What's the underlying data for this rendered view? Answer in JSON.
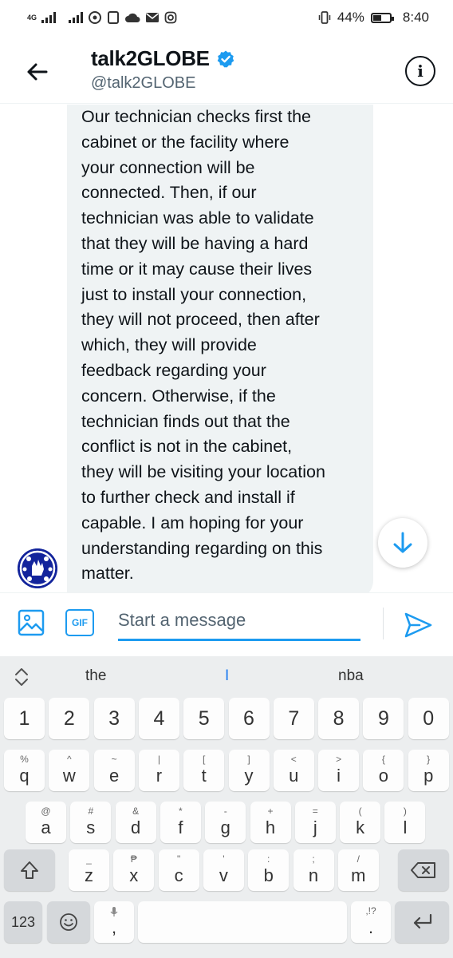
{
  "status_bar": {
    "network_label": "4G",
    "battery_percent": "44%",
    "time": "8:40"
  },
  "header": {
    "title": "talk2GLOBE",
    "handle": "@talk2GLOBE",
    "back_icon": "arrow-left-icon",
    "verified_icon": "verified-badge-icon",
    "info_icon": "info-icon",
    "info_glyph": "i"
  },
  "messages": [
    {
      "sender": "talk2GLOBE",
      "text": "Our technician checks first the\ncabinet or the facility where\nyour connection will be\nconnected. Then, if our\ntechnician was able to validate\nthat they will be having a hard\ntime or it may cause their lives\njust to install your connection,\nthey will not proceed, then after\nwhich, they will provide\nfeedback regarding your\nconcern. Otherwise, if the\ntechnician finds out that the\nconflict is not in the cabinet,\nthey will be visiting your location\nto further check and install if\ncapable. I am hoping for your\nunderstanding regarding on this\nmatter."
    }
  ],
  "composer": {
    "placeholder": "Start a message",
    "gif_label": "GIF",
    "media_icon": "image-icon",
    "send_icon": "send-icon"
  },
  "keyboard": {
    "suggestions": [
      "the",
      "I",
      "nba"
    ],
    "number_row": [
      "1",
      "2",
      "3",
      "4",
      "5",
      "6",
      "7",
      "8",
      "9",
      "0"
    ],
    "row1": [
      {
        "sub": "%",
        "main": "q"
      },
      {
        "sub": "^",
        "main": "w"
      },
      {
        "sub": "~",
        "main": "e"
      },
      {
        "sub": "|",
        "main": "r"
      },
      {
        "sub": "[",
        "main": "t"
      },
      {
        "sub": "]",
        "main": "y"
      },
      {
        "sub": "<",
        "main": "u"
      },
      {
        "sub": ">",
        "main": "i"
      },
      {
        "sub": "{",
        "main": "o"
      },
      {
        "sub": "}",
        "main": "p"
      }
    ],
    "row2": [
      {
        "sub": "@",
        "main": "a"
      },
      {
        "sub": "#",
        "main": "s"
      },
      {
        "sub": "&",
        "main": "d"
      },
      {
        "sub": "*",
        "main": "f"
      },
      {
        "sub": "-",
        "main": "g"
      },
      {
        "sub": "+",
        "main": "h"
      },
      {
        "sub": "=",
        "main": "j"
      },
      {
        "sub": "(",
        "main": "k"
      },
      {
        "sub": ")",
        "main": "l"
      }
    ],
    "row3": [
      {
        "sub": "_",
        "main": "z"
      },
      {
        "sub": "₱",
        "main": "x"
      },
      {
        "sub": "\"",
        "main": "c"
      },
      {
        "sub": "'",
        "main": "v"
      },
      {
        "sub": ":",
        "main": "b"
      },
      {
        "sub": ";",
        "main": "n"
      },
      {
        "sub": "/",
        "main": "m"
      }
    ],
    "bottom": {
      "symbols_label": "123",
      "comma_label": ",",
      "period_label": ".",
      "period_sub": ",!?"
    }
  }
}
